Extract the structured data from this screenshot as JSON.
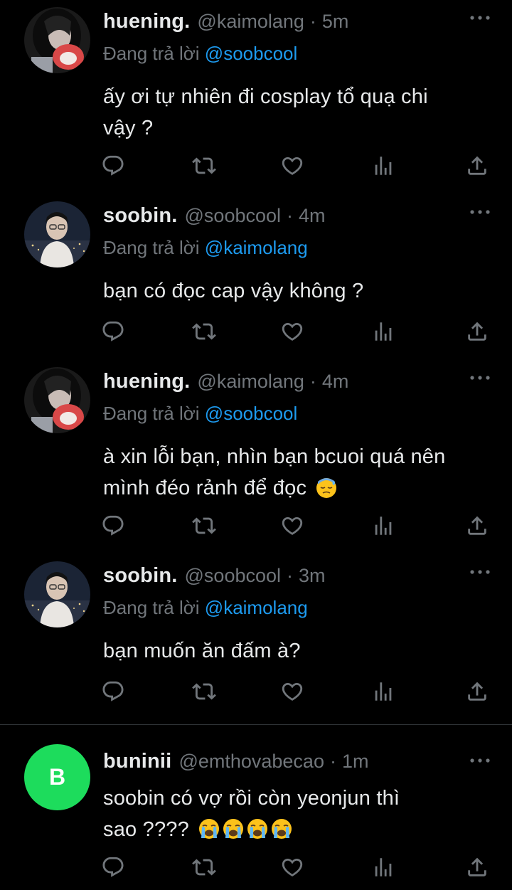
{
  "tweets": [
    {
      "name": "huening.",
      "handle": "@kaimolang",
      "separator": "·",
      "time": "5m",
      "replying_label": "Đang trả lời",
      "replying_to": "@soobcool",
      "text_lines": [
        "ấy ơi tự nhiên đi cosplay tổ quạ chi",
        "vậy ?"
      ],
      "avatar": "photo-girl-dark"
    },
    {
      "name": "soobin.",
      "handle": "@soobcool",
      "separator": "·",
      "time": "4m",
      "replying_label": "Đang trả lời",
      "replying_to": "@kaimolang",
      "text_lines": [
        "bạn có đọc cap vậy không ?"
      ],
      "avatar": "photo-boy-city"
    },
    {
      "name": "huening.",
      "handle": "@kaimolang",
      "separator": "·",
      "time": "4m",
      "replying_label": "Đang trả lời",
      "replying_to": "@soobcool",
      "text_lines": [
        "à xin lỗi bạn, nhìn bạn bcuoi quá nên",
        "mình đéo rảnh để đọc"
      ],
      "emoji": [
        "downcast-sweat-face"
      ],
      "avatar": "photo-girl-dark"
    },
    {
      "name": "soobin.",
      "handle": "@soobcool",
      "separator": "·",
      "time": "3m",
      "replying_label": "Đang trả lời",
      "replying_to": "@kaimolang",
      "text_lines": [
        "bạn muốn ăn đấm à?"
      ],
      "avatar": "photo-boy-city"
    },
    {
      "name": "buninii",
      "handle": "@emthovabecao",
      "separator": "·",
      "time": "1m",
      "avatar_letter": "B",
      "avatar_color": "#1ddc5c",
      "text_lines": [
        "soobin có vợ rồi còn yeonjun thì",
        "sao ????"
      ],
      "emoji": [
        "crying-face",
        "crying-face",
        "crying-face",
        "crying-face"
      ]
    }
  ],
  "action_icons": [
    "reply-icon",
    "retweet-icon",
    "like-icon",
    "views-icon",
    "share-icon"
  ],
  "more_icon": "more-icon",
  "colors": {
    "background": "#000000",
    "text": "#e7e9ea",
    "muted": "#71767b",
    "mention": "#1d9bf0",
    "divider": "#2f3336"
  }
}
